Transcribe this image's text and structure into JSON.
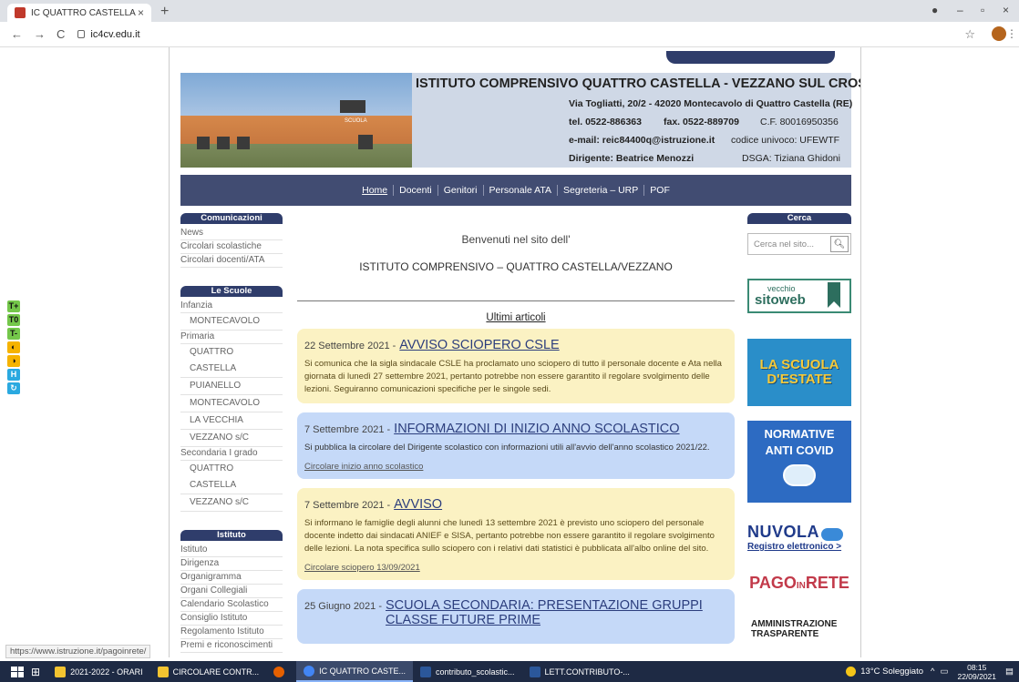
{
  "browser": {
    "tab_title": "IC QUATTRO CASTELLA",
    "tab_close": "×",
    "new_tab": "+",
    "url": "ic4cv.edu.it",
    "back": "←",
    "forward": "→",
    "reload": "C",
    "star": "☆",
    "menu": "⋮",
    "win_min": "–",
    "win_max": "▫",
    "win_close": "×",
    "status_url": "https://www.istruzione.it/pagoinrete/"
  },
  "header": {
    "title": "ISTITUTO COMPRENSIVO  QUATTRO CASTELLA - VEZZANO SUL CROSTOLO",
    "address": "Via Togliatti, 20/2 - 42020 Montecavolo di Quattro Castella (RE)",
    "tel": "tel. 0522-886363",
    "fax": "fax. 0522-889709",
    "cf": "C.F. 80016950356",
    "email": "e-mail: reic84400q@istruzione.it",
    "codice": "codice univoco: UFEWTF",
    "dirigente": "Dirigente: Beatrice Menozzi",
    "dsga": "DSGA: Tiziana Ghidoni",
    "photo_sign": "SCUOLA"
  },
  "nav": [
    "Home",
    "Docenti",
    "Genitori",
    "Personale ATA",
    "Segreteria – URP",
    "POF"
  ],
  "left": {
    "comunicazioni": {
      "title": "Comunicazioni",
      "items": [
        "News",
        "Circolari scolastiche",
        "Circolari docenti/ATA"
      ]
    },
    "scuole": {
      "title": "Le Scuole",
      "items": [
        "Infanzia",
        "MONTECAVOLO",
        "Primaria",
        "QUATTRO CASTELLA",
        "PUIANELLO",
        "MONTECAVOLO",
        "LA VECCHIA",
        "VEZZANO s/C",
        "Secondaria I grado",
        "QUATTRO CASTELLA",
        "VEZZANO s/C"
      ]
    },
    "istituto": {
      "title": "Istituto",
      "items": [
        "Istituto",
        "Dirigenza",
        "Organigramma",
        "Organi Collegiali",
        "Calendario Scolastico",
        "Consiglio Istituto",
        "Regolamento Istituto",
        "Premi e riconoscimenti"
      ]
    }
  },
  "center": {
    "welcome1": "Benvenuti nel sito dell'",
    "welcome2": "ISTITUTO COMPRENSIVO – QUATTRO CASTELLA/VEZZANO",
    "ultimi": "Ultimi articoli",
    "articles": [
      {
        "date": "22 Settembre 2021 -",
        "title": "AVVISO SCIOPERO CSLE",
        "text": "Si comunica che la sigla sindacale CSLE ha proclamato uno sciopero di tutto il personale docente e Ata nella giornata di lunedì 27 settembre 2021, pertanto potrebbe non essere garantito il regolare svolgimento delle lezioni. Seguiranno comunicazioni specifiche per le singole sedi.",
        "link": ""
      },
      {
        "date": "7 Settembre 2021 -",
        "title": "INFORMAZIONI DI INIZIO ANNO SCOLASTICO",
        "text": "Si pubblica la circolare del Dirigente scolastico con informazioni utili all'avvio dell'anno scolastico 2021/22.",
        "link": "Circolare inizio anno scolastico"
      },
      {
        "date": "7 Settembre 2021 -",
        "title": "AVVISO",
        "text": "Si informano le famiglie degli alunni che lunedì 13 settembre 2021 è previsto uno sciopero del personale docente indetto dai sindacati ANIEF e SISA, pertanto potrebbe non essere garantito il regolare svolgimento delle lezioni. La nota specifica sullo sciopero con i relativi dati statistici è pubblicata all'albo online del sito.",
        "link": "Circolare sciopero 13/09/2021"
      },
      {
        "date": "25 Giugno 2021 -",
        "title": "SCUOLA SECONDARIA: PRESENTAZIONE GRUPPI CLASSE FUTURE PRIME",
        "text": "",
        "link": ""
      }
    ]
  },
  "right": {
    "cerca_title": "Cerca",
    "search_placeholder": "Cerca nel sito...",
    "vecchio1": "vecchio",
    "vecchio2": "sitoweb",
    "scuola1": "LA SCUOLA",
    "scuola2": "D'ESTATE",
    "covid1": "NORMATIVE",
    "covid2": "ANTI COVID",
    "nuvola1": "NUVOLA",
    "nuvola2": "Registro elettronico >",
    "pago1": "PAGO",
    "pago_in": "IN",
    "pago2": "RETE",
    "amm1": "AMMINISTRAZIONE",
    "amm2": "TRASPARENTE"
  },
  "acc_toolbar": [
    "T+",
    "T0",
    "T-",
    "◐",
    "◑",
    "H",
    "↻"
  ],
  "taskbar": {
    "items": [
      "2021-2022 - ORARI",
      "CIRCOLARE CONTR...",
      "",
      "IC QUATTRO CASTE...",
      "contributo_scolastic...",
      "LETT.CONTRIBUTO-..."
    ],
    "weather": "13°C  Soleggiato",
    "time": "08:15",
    "date": "22/09/2021"
  },
  "colors": {
    "nav": "#414c72",
    "side_head": "#2f3d6b",
    "yellow_card": "#fbf2c3",
    "blue_card": "#c5d9f8",
    "title_link": "#2c3e7d"
  }
}
